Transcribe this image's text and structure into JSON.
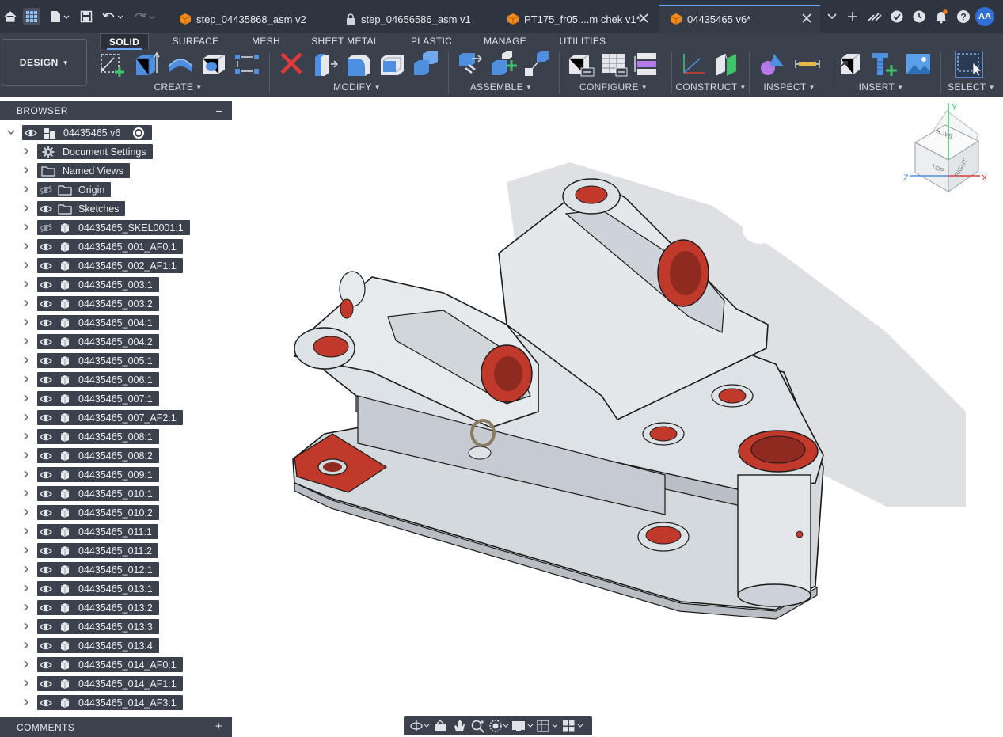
{
  "tabs": [
    {
      "label": "step_04435868_asm v2",
      "icon": "component-cube-icon",
      "active": false
    },
    {
      "label": "step_04656586_asm v1",
      "icon": "lock-icon",
      "active": false
    },
    {
      "label": "PT175_fr05....m chek v1*",
      "icon": "component-cube-icon",
      "active": false
    },
    {
      "label": "04435465 v6*",
      "icon": "component-cube-icon",
      "active": true
    }
  ],
  "user": {
    "initials": "AA"
  },
  "ribbon": {
    "workspace": "DESIGN",
    "tabs": [
      "SOLID",
      "SURFACE",
      "MESH",
      "SHEET METAL",
      "PLASTIC",
      "MANAGE",
      "UTILITIES"
    ],
    "active_tab": "SOLID",
    "groups": [
      "CREATE",
      "MODIFY",
      "ASSEMBLE",
      "CONFIGURE",
      "CONSTRUCT",
      "INSPECT",
      "INSERT",
      "SELECT"
    ]
  },
  "browser": {
    "title": "BROWSER",
    "root": "04435465 v6",
    "items": [
      {
        "label": "Document Settings",
        "type": "settings",
        "eye": "none"
      },
      {
        "label": "Named Views",
        "type": "folder",
        "eye": "none"
      },
      {
        "label": "Origin",
        "type": "folder",
        "eye": "hidden"
      },
      {
        "label": "Sketches",
        "type": "folder",
        "eye": "visible"
      },
      {
        "label": "04435465_SKEL0001:1",
        "type": "component",
        "eye": "hidden"
      },
      {
        "label": "04435465_001_AF0:1",
        "type": "component",
        "eye": "visible"
      },
      {
        "label": "04435465_002_AF1:1",
        "type": "component",
        "eye": "visible"
      },
      {
        "label": "04435465_003:1",
        "type": "component",
        "eye": "visible"
      },
      {
        "label": "04435465_003:2",
        "type": "component",
        "eye": "visible"
      },
      {
        "label": "04435465_004:1",
        "type": "component",
        "eye": "visible"
      },
      {
        "label": "04435465_004:2",
        "type": "component",
        "eye": "visible"
      },
      {
        "label": "04435465_005:1",
        "type": "component",
        "eye": "visible"
      },
      {
        "label": "04435465_006:1",
        "type": "component",
        "eye": "visible"
      },
      {
        "label": "04435465_007:1",
        "type": "component",
        "eye": "visible"
      },
      {
        "label": "04435465_007_AF2:1",
        "type": "component",
        "eye": "visible"
      },
      {
        "label": "04435465_008:1",
        "type": "component",
        "eye": "visible"
      },
      {
        "label": "04435465_008:2",
        "type": "component",
        "eye": "visible"
      },
      {
        "label": "04435465_009:1",
        "type": "component",
        "eye": "visible"
      },
      {
        "label": "04435465_010:1",
        "type": "component",
        "eye": "visible"
      },
      {
        "label": "04435465_010:2",
        "type": "component",
        "eye": "visible"
      },
      {
        "label": "04435465_011:1",
        "type": "component",
        "eye": "visible"
      },
      {
        "label": "04435465_011:2",
        "type": "component",
        "eye": "visible"
      },
      {
        "label": "04435465_012:1",
        "type": "component",
        "eye": "visible"
      },
      {
        "label": "04435465_013:1",
        "type": "component",
        "eye": "visible"
      },
      {
        "label": "04435465_013:2",
        "type": "component",
        "eye": "visible"
      },
      {
        "label": "04435465_013:3",
        "type": "component",
        "eye": "visible"
      },
      {
        "label": "04435465_013:4",
        "type": "component",
        "eye": "visible"
      },
      {
        "label": "04435465_014_AF0:1",
        "type": "component",
        "eye": "visible"
      },
      {
        "label": "04435465_014_AF1:1",
        "type": "component",
        "eye": "visible"
      },
      {
        "label": "04435465_014_AF3:1",
        "type": "component",
        "eye": "visible"
      }
    ]
  },
  "comments": {
    "title": "COMMENTS"
  },
  "viewcube": {
    "axis_y": "Y",
    "axis_x": "X",
    "axis_z": "Z",
    "face_top": "TOP",
    "face_right": "RIGHT",
    "face_back": "BACK"
  },
  "colors": {
    "accent": "#6aa8ff",
    "model_body": "#d8dde2",
    "model_highlight": "#c0392b",
    "panel": "#3b424d"
  }
}
